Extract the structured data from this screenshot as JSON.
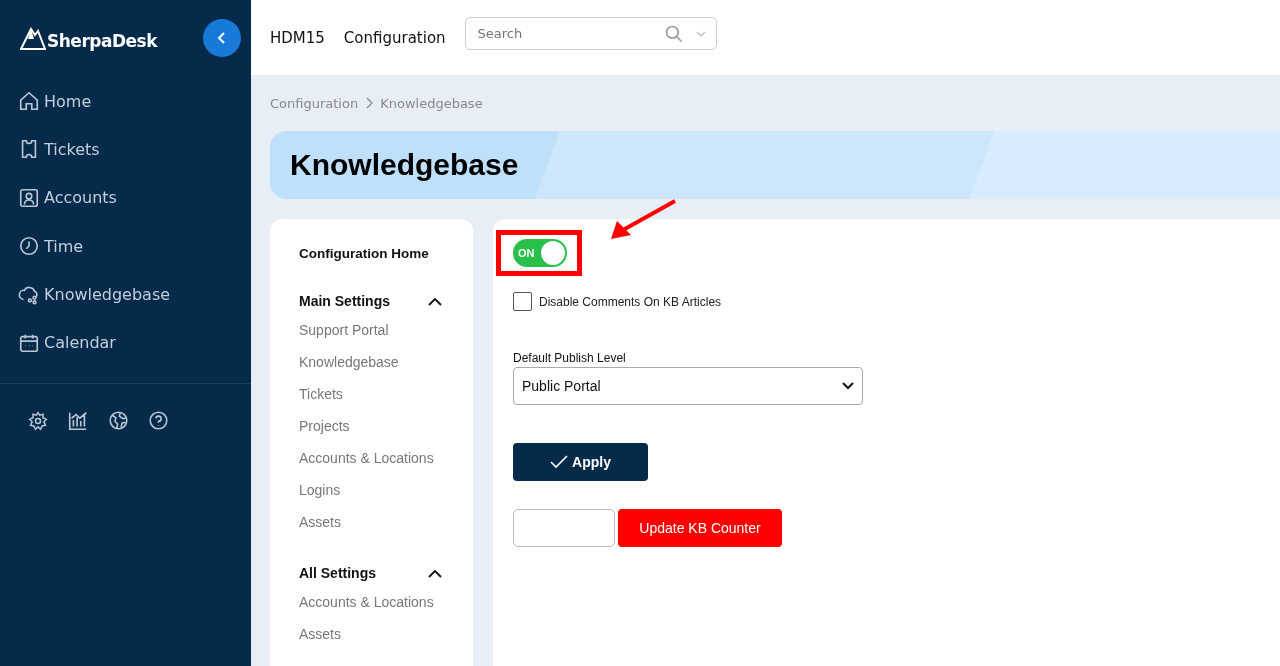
{
  "sidebar": {
    "logo": "SherpaDesk",
    "items": [
      {
        "label": "Home"
      },
      {
        "label": "Tickets"
      },
      {
        "label": "Accounts"
      },
      {
        "label": "Time"
      },
      {
        "label": "Knowledgebase"
      },
      {
        "label": "Calendar"
      }
    ]
  },
  "topbar": {
    "org": "HDM15",
    "title": "Configuration",
    "search": {
      "placeholder": "Search"
    }
  },
  "breadcrumb": [
    "Configuration",
    "Knowledgebase"
  ],
  "page_title": "Knowledgebase",
  "config_nav": {
    "home": "Configuration Home",
    "sections": [
      {
        "title": "Main Settings",
        "expanded": true,
        "items": [
          "Support Portal",
          "Knowledgebase",
          "Tickets",
          "Projects",
          "Accounts & Locations",
          "Logins",
          "Assets"
        ]
      },
      {
        "title": "All Settings",
        "expanded": true,
        "items": [
          "Accounts & Locations",
          "Assets"
        ]
      }
    ]
  },
  "form": {
    "toggle": {
      "label": "ON",
      "on": true
    },
    "disable_comments": {
      "label": "Disable Comments On KB Articles",
      "checked": false
    },
    "publish_level": {
      "label": "Default Publish Level",
      "value": "Public Portal"
    },
    "apply": "Apply",
    "counter_button": "Update KB Counter"
  }
}
